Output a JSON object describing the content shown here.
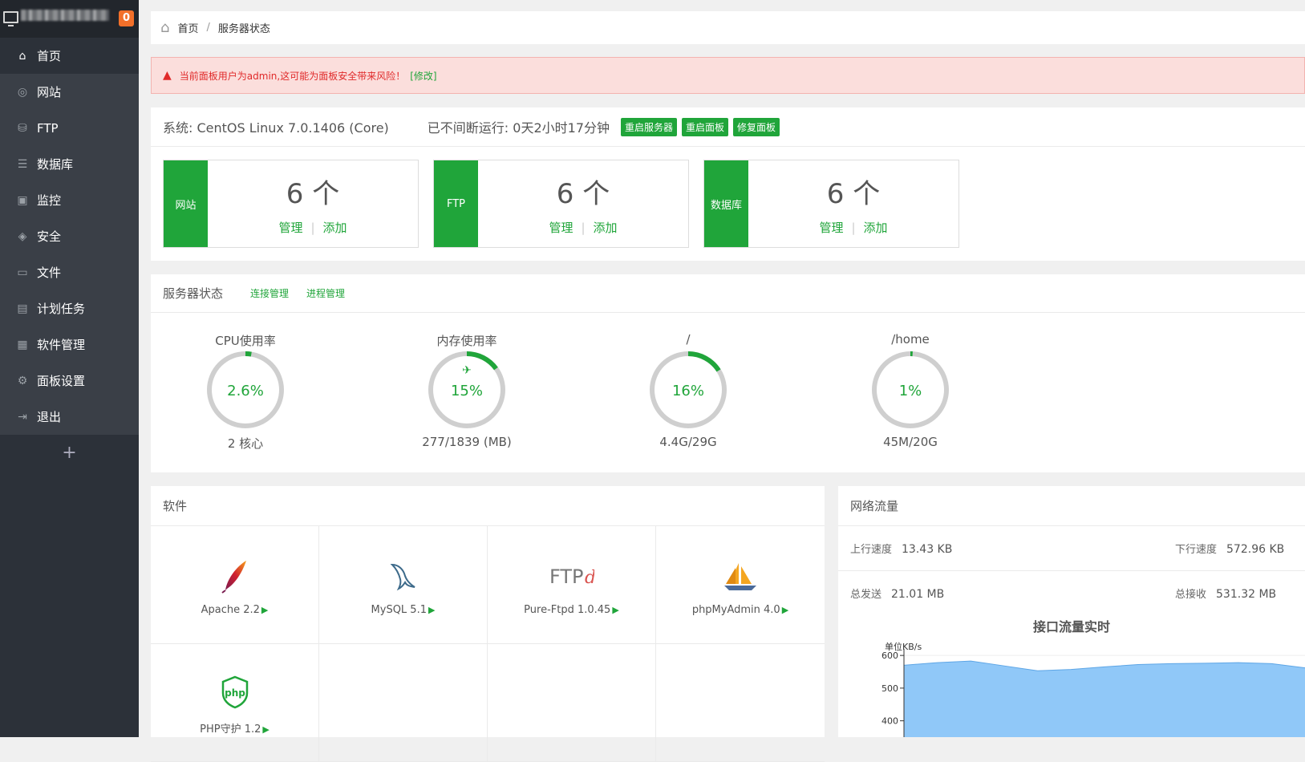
{
  "sidebar": {
    "badge": "0",
    "items": [
      {
        "label": "首页",
        "icon": "home-icon",
        "glyph": "⌂"
      },
      {
        "label": "网站",
        "icon": "globe-icon",
        "glyph": "◎"
      },
      {
        "label": "FTP",
        "icon": "ftp-icon",
        "glyph": "⛁"
      },
      {
        "label": "数据库",
        "icon": "database-icon",
        "glyph": "☰"
      },
      {
        "label": "监控",
        "icon": "monitor-icon",
        "glyph": "▣"
      },
      {
        "label": "安全",
        "icon": "shield-icon",
        "glyph": "◈"
      },
      {
        "label": "文件",
        "icon": "folder-icon",
        "glyph": "▭"
      },
      {
        "label": "计划任务",
        "icon": "calendar-icon",
        "glyph": "▤"
      },
      {
        "label": "软件管理",
        "icon": "apps-icon",
        "glyph": "▦"
      },
      {
        "label": "面板设置",
        "icon": "gear-icon",
        "glyph": "⚙"
      },
      {
        "label": "退出",
        "icon": "logout-icon",
        "glyph": "⇥"
      }
    ],
    "add": "+"
  },
  "breadcrumb": {
    "home": "首页",
    "sep": "/",
    "current": "服务器状态"
  },
  "alert": {
    "text": "当前面板用户为admin,这可能为面板安全带来风险！",
    "fix": "[修改]"
  },
  "system": {
    "os": "系统: CentOS Linux 7.0.1406 (Core)",
    "uptime": "已不间断运行: 0天2小时17分钟",
    "buttons": [
      "重启服务器",
      "重启面板",
      "修复面板"
    ]
  },
  "cards": [
    {
      "tag": "网站",
      "count": "6 个",
      "manage": "管理",
      "add": "添加"
    },
    {
      "tag": "FTP",
      "count": "6 个",
      "manage": "管理",
      "add": "添加"
    },
    {
      "tag": "数据库",
      "count": "6 个",
      "manage": "管理",
      "add": "添加"
    }
  ],
  "status": {
    "title": "服务器状态",
    "links": [
      "连接管理",
      "进程管理"
    ],
    "gauges": [
      {
        "label": "CPU使用率",
        "value": "2.6%",
        "percent": 2.6,
        "sub": "2 核心"
      },
      {
        "label": "内存使用率",
        "value": "15%",
        "percent": 15,
        "sub": "277/1839 (MB)"
      },
      {
        "label": "/",
        "value": "16%",
        "percent": 16,
        "sub": "4.4G/29G"
      },
      {
        "label": "/home",
        "value": "1%",
        "percent": 1,
        "sub": "45M/20G"
      }
    ]
  },
  "software": {
    "title": "软件",
    "items": [
      {
        "name": "Apache 2.2",
        "icon": "apache-feather-icon"
      },
      {
        "name": "MySQL 5.1",
        "icon": "mysql-dolphin-icon"
      },
      {
        "name": "Pure-Ftpd 1.0.45",
        "icon": "pure-ftpd-icon"
      },
      {
        "name": "phpMyAdmin 4.0",
        "icon": "phpmyadmin-sailboat-icon"
      },
      {
        "name": "PHP守护 1.2",
        "icon": "php-shield-icon"
      }
    ]
  },
  "network": {
    "title": "网络流量",
    "up_label": "上行速度",
    "up_value": "13.43 KB",
    "down_label": "下行速度",
    "down_value": "572.96 KB",
    "sent_label": "总发送",
    "sent_value": "21.01 MB",
    "recv_label": "总接收",
    "recv_value": "531.32 MB",
    "chart_title": "接口流量实时",
    "chart_unit": "单位KB/s"
  },
  "chart_data": {
    "type": "area",
    "title": "接口流量实时",
    "ylabel": "单位KB/s",
    "yticks": [
      600,
      500,
      400
    ],
    "ylim": [
      350,
      620
    ],
    "values": [
      570,
      578,
      583,
      568,
      553,
      557,
      565,
      572,
      575,
      576,
      578,
      575,
      562
    ],
    "color": "#90c8f8"
  },
  "colors": {
    "accent": "#20a53a",
    "sidebar": "#3a3f47",
    "alert_bg": "#fbdedc",
    "alert_text": "#e02a2a"
  }
}
